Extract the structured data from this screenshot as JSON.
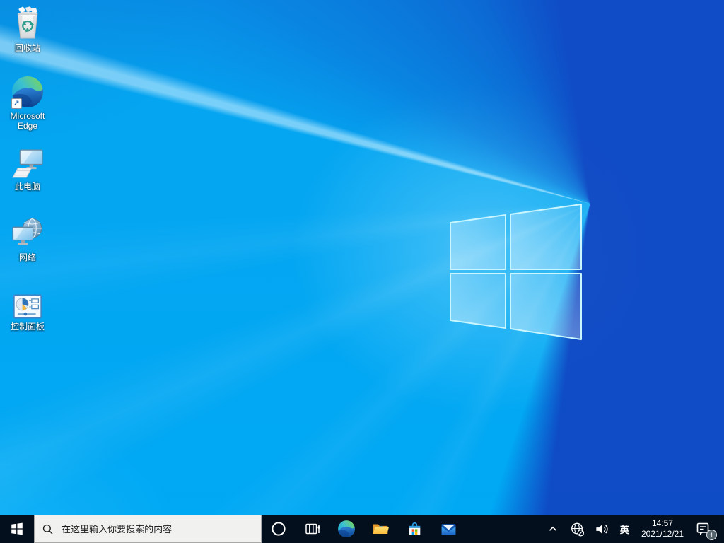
{
  "desktop": {
    "wallpaper": "windows10-default-light-rays",
    "icons": [
      {
        "name": "recycle-bin",
        "label": "回收站"
      },
      {
        "name": "microsoft-edge",
        "label": "Microsoft Edge",
        "shortcut_arrow": "↗"
      },
      {
        "name": "this-pc",
        "label": "此电脑"
      },
      {
        "name": "network",
        "label": "网络"
      },
      {
        "name": "control-panel",
        "label": "控制面板"
      }
    ]
  },
  "taskbar": {
    "start": {
      "icon": "windows-logo-icon"
    },
    "search": {
      "icon": "search-icon",
      "placeholder": "在这里输入你要搜索的内容"
    },
    "buttons": [
      {
        "name": "cortana"
      },
      {
        "name": "task-view"
      },
      {
        "name": "microsoft-edge"
      },
      {
        "name": "file-explorer"
      },
      {
        "name": "microsoft-store"
      },
      {
        "name": "mail"
      }
    ],
    "tray": {
      "expand_icon": "chevron-up-icon",
      "network_icon": "globe-no-internet-icon",
      "volume_icon": "speaker-icon",
      "ime": "英",
      "time": "14:57",
      "date": "2021/12/21",
      "notification_icon": "action-center-icon",
      "notification_count": "1"
    }
  },
  "colors": {
    "wallpaper_bright": "#00a9f4",
    "wallpaper_dark": "#1152c3",
    "logo_border": "#c9f6ff",
    "taskbar_bg": "#030f1c",
    "search_bg": "#f1f1ef",
    "badge_bg": "#56646e"
  }
}
